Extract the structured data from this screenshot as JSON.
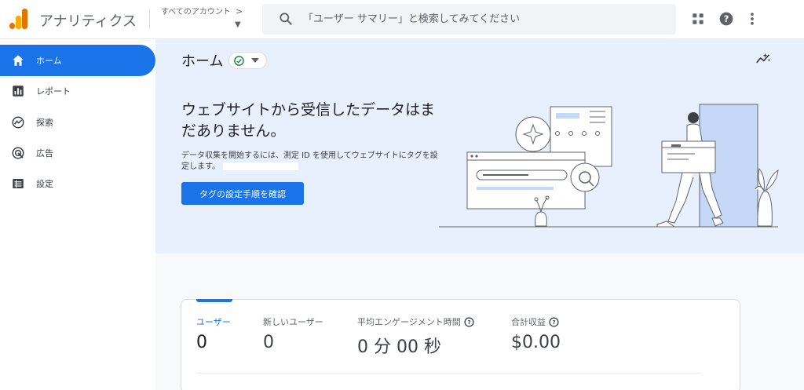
{
  "header": {
    "app_title": "アナリティクス",
    "account_label": "すべてのアカウント",
    "account_chevron": ">",
    "search_placeholder": "「ユーザー サマリー」と検索してみてください"
  },
  "sidebar": {
    "items": [
      {
        "label": "ホーム",
        "icon": "home-icon",
        "active": true
      },
      {
        "label": "レポート",
        "icon": "bar-chart-icon",
        "active": false
      },
      {
        "label": "探索",
        "icon": "explore-icon",
        "active": false
      },
      {
        "label": "広告",
        "icon": "ads-icon",
        "active": false
      },
      {
        "label": "設定",
        "icon": "settings-icon",
        "active": false
      }
    ]
  },
  "main": {
    "page_title": "ホーム",
    "headline": "ウェブサイトから受信したデータはまだありません。",
    "description": "データ収集を開始するには、測定 ID を使用してウェブサイトにタグを設定します。",
    "cta_label": "タグの設定手順を確認"
  },
  "metrics": [
    {
      "label": "ユーザー",
      "value": "0",
      "active": true,
      "help": false
    },
    {
      "label": "新しいユーザー",
      "value": "0",
      "active": false,
      "help": false
    },
    {
      "label": "平均エンゲージメント時間",
      "value": "0 分 00 秒",
      "active": false,
      "help": true
    },
    {
      "label": "合計収益",
      "value": "$0.00",
      "active": false,
      "help": true
    }
  ],
  "colors": {
    "accent": "#1a73e8",
    "banner_bg": "#e8f0fe",
    "logo_orange": "#f9ab00",
    "logo_dark_orange": "#e37400",
    "status_green": "#188038"
  }
}
